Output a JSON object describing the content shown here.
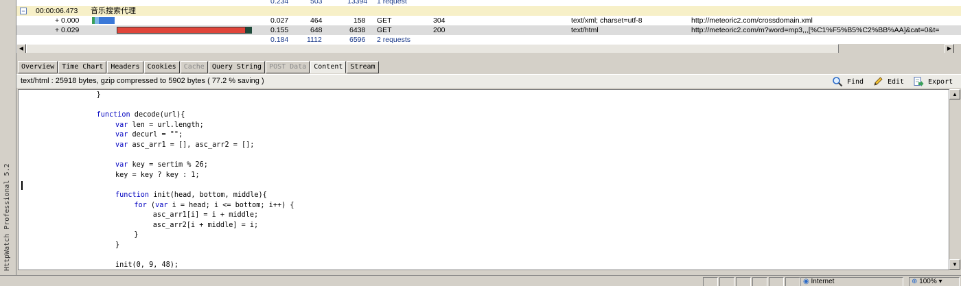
{
  "app": {
    "title": "HttpWatch Professional 5.2"
  },
  "requests": {
    "prev_summary": {
      "time": "0.234",
      "sent": "503",
      "received": "13394",
      "method": "1 request"
    },
    "group": {
      "expander": "−",
      "timestamp": "00:00:06.473",
      "title": "音乐搜索代理"
    },
    "rows": [
      {
        "offset": "+ 0.000",
        "time": "0.027",
        "sent": "464",
        "received": "158",
        "method": "GET",
        "result": "304",
        "type": "text/xml; charset=utf-8",
        "url": "http://meteoric2.com/crossdomain.xml"
      },
      {
        "offset": "+ 0.029",
        "time": "0.155",
        "sent": "648",
        "received": "6438",
        "method": "GET",
        "result": "200",
        "type": "text/html",
        "url": "http://meteoric2.com/m?word=mp3,,,[%C1%F5%B5%C2%BB%AA]&cat=0&t="
      }
    ],
    "summary": {
      "time": "0.184",
      "sent": "1112",
      "received": "6596",
      "method": "2 requests"
    }
  },
  "tabs": [
    {
      "label": "Overview",
      "state": "normal"
    },
    {
      "label": "Time Chart",
      "state": "normal"
    },
    {
      "label": "Headers",
      "state": "normal"
    },
    {
      "label": "Cookies",
      "state": "normal"
    },
    {
      "label": "Cache",
      "state": "disabled"
    },
    {
      "label": "Query String",
      "state": "normal"
    },
    {
      "label": "POST Data",
      "state": "disabled"
    },
    {
      "label": "Content",
      "state": "active"
    },
    {
      "label": "Stream",
      "state": "normal"
    }
  ],
  "content_info": "text/html : 25918 bytes, gzip compressed to 5902 bytes ( 77.2 % saving )",
  "toolbar": {
    "find": "Find",
    "edit": "Edit",
    "export": "Export"
  },
  "code_lines": [
    {
      "indent": 16,
      "text": "}"
    },
    {
      "indent": 0,
      "text": ""
    },
    {
      "indent": 16,
      "kw": "function",
      "text": " decode(url){"
    },
    {
      "indent": 20,
      "kw": "var",
      "text": " len = url.length;"
    },
    {
      "indent": 20,
      "kw": "var",
      "text": " decurl = \"\";"
    },
    {
      "indent": 20,
      "kw": "var",
      "text": " asc_arr1 = [], asc_arr2 = [];"
    },
    {
      "indent": 0,
      "text": ""
    },
    {
      "indent": 20,
      "kw": "var",
      "text": " key = sertim % 26;"
    },
    {
      "indent": 20,
      "text": "key = key ? key : 1;"
    },
    {
      "indent": 0,
      "text": ""
    },
    {
      "indent": 20,
      "kw": "function",
      "text": " init(head, bottom, middle){"
    },
    {
      "indent": 24,
      "kw": "for",
      "text": " (",
      "kw2": "var",
      "text2": " i = head; i <= bottom; i++) {"
    },
    {
      "indent": 28,
      "text": "asc_arr1[i] = i + middle;"
    },
    {
      "indent": 28,
      "text": "asc_arr2[i + middle] = i;"
    },
    {
      "indent": 24,
      "text": "}"
    },
    {
      "indent": 20,
      "text": "}"
    },
    {
      "indent": 0,
      "text": ""
    },
    {
      "indent": 20,
      "text": "init(0, 9, 48);"
    }
  ],
  "status": {
    "zone": "Internet",
    "zoom": "100%"
  },
  "colors": {
    "bar_red": "#e0453a",
    "bar_dark": "#1e4a3a",
    "bar_blue": "#3a78d8",
    "bar_green": "#3aa05a",
    "keyword": "#0000c0",
    "summary_text": "#1a3a8a"
  }
}
